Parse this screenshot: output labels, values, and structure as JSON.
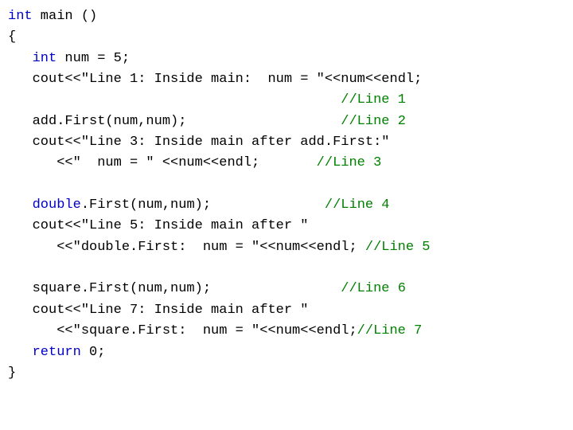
{
  "code": {
    "l01_kw": "int",
    "l01_txt": " main ()",
    "l02_txt": "{",
    "l03_pad": "   ",
    "l03_kw": "int",
    "l03_txt": " num = 5;",
    "l04_txt": "   cout<<\"Line 1: Inside main:",
    "l04_end": "  num = \"<<num<<endl;",
    "l05_pad": "                                         ",
    "l05_cmt": "//Line 1",
    "l06_txt": "   add.First(num,num);                   ",
    "l06_cmt": "//Line 2",
    "l07_txt": "   cout<<\"Line 3: Inside main after add.First:\"",
    "l08_txt": "      <<\"  num = \" <<num<<endl;       ",
    "l08_cmt": "//Line 3",
    "blank": "",
    "l09_pad": "   ",
    "l09_kw": "double",
    "l09_txt": ".First(num,num);              ",
    "l09_cmt": "//Line 4",
    "l10_txt": "   cout<<\"Line 5: Inside main after \"",
    "l11_txt": "      <<\"double.First:  num = \"<<num<<endl; ",
    "l11_cmt": "//Line 5",
    "l12_txt": "   square.First(num,num);                ",
    "l12_cmt": "//Line 6",
    "l13_txt": "   cout<<\"Line 7: Inside main after \"",
    "l14_txt": "      <<\"square.First:  num = \"<<num<<endl;",
    "l14_cmt": "//Line 7",
    "l15_pad": "   ",
    "l15_kw": "return",
    "l15_txt": " 0;",
    "l16_txt": "}"
  }
}
